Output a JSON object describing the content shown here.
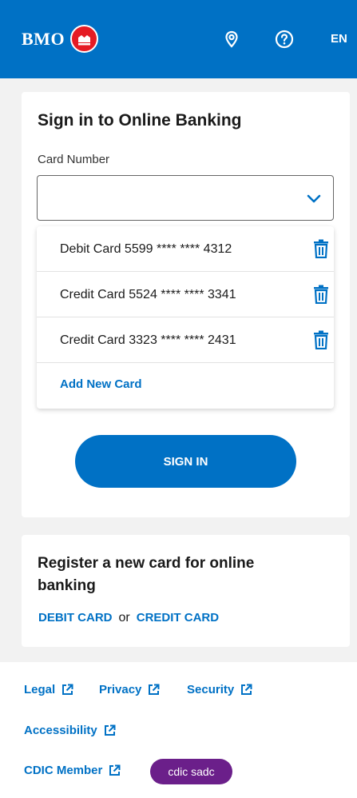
{
  "header": {
    "logo_text": "BMO",
    "language": "EN",
    "location_icon": "location-pin-icon",
    "help_icon": "help-circle-icon",
    "brand_color": "#0071c5"
  },
  "signin_card": {
    "title": "Sign in to Online Banking",
    "card_number_label": "Card Number",
    "card_number_value": "",
    "cards": [
      {
        "label": "Debit Card 5599 **** **** 4312"
      },
      {
        "label": "Credit Card 5524 **** **** 3341"
      },
      {
        "label": "Credit Card 3323 **** **** 2431"
      }
    ],
    "add_new_card": "Add New Card",
    "sign_in_button": "SIGN IN"
  },
  "register_card": {
    "title": "Register a new card for online banking",
    "debit_link": "DEBIT CARD",
    "or_text": "or",
    "credit_link": "CREDIT CARD"
  },
  "footer": {
    "legal": "Legal",
    "privacy": "Privacy",
    "security": "Security",
    "accessibility": "Accessibility",
    "cdic_member": "CDIC Member",
    "cdic_badge": "cdic sadc"
  }
}
